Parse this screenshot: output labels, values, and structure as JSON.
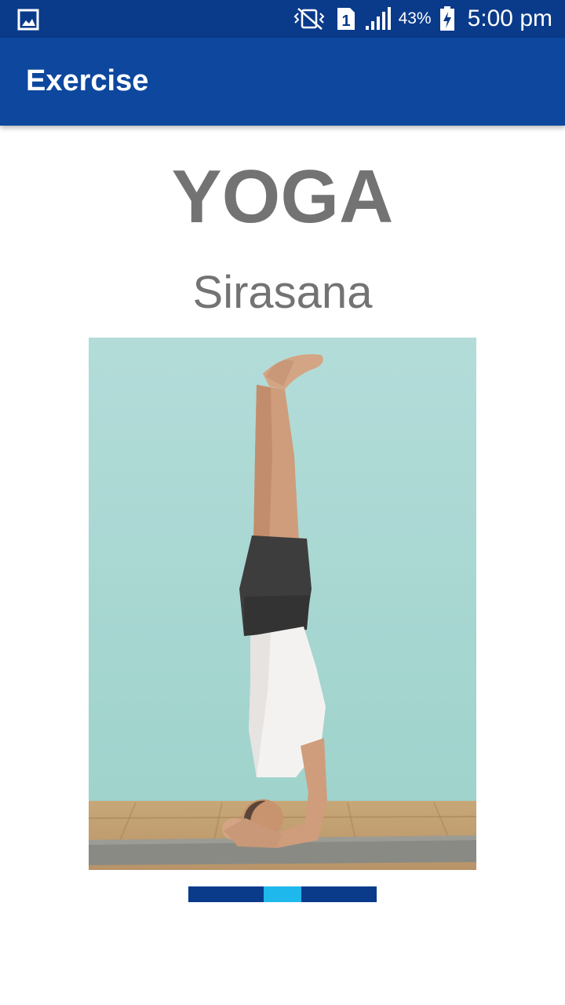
{
  "status_bar": {
    "left_icon": "gallery-icon",
    "icons": [
      "vibrate-icon",
      "sim-1-icon",
      "signal-icon",
      "battery-charging-icon"
    ],
    "battery_percent": "43%",
    "time": "5:00 pm"
  },
  "app_bar": {
    "title": "Exercise"
  },
  "content": {
    "heading": "YOGA",
    "subheading": "Sirasana",
    "image_subject": "headstand-yoga-pose"
  },
  "pager": {
    "page_count": 5,
    "active_index": 2
  },
  "colors": {
    "status_bar": "#0a3a8a",
    "app_bar": "#0d479e",
    "text_grey": "#737373",
    "indicator": "#0a3a8a",
    "indicator_active": "#1fb8ec",
    "wall": "#a8d8d4",
    "floor": "#c9a97c"
  }
}
